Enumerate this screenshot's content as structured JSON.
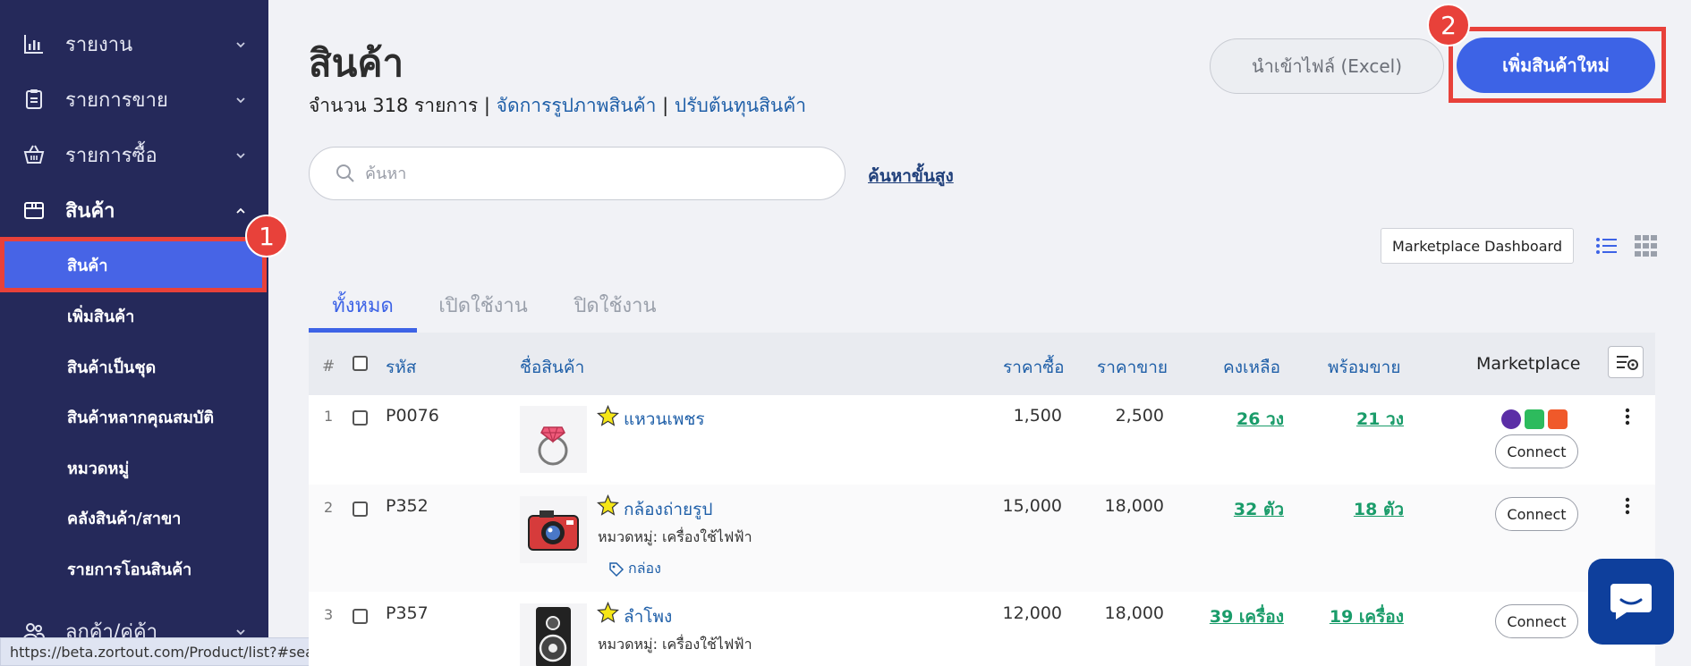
{
  "sidebar": {
    "items": [
      {
        "label": "รายงาน",
        "icon": "bar-chart-icon"
      },
      {
        "label": "รายการขาย",
        "icon": "clipboard-icon"
      },
      {
        "label": "รายการซื้อ",
        "icon": "basket-icon"
      },
      {
        "label": "สินค้า",
        "icon": "box-icon"
      },
      {
        "label": "ลูกค้า/คู่ค้า",
        "icon": "users-icon"
      }
    ],
    "subitems": [
      "สินค้า",
      "เพิ่มสินค้า",
      "สินค้าเป็นชุด",
      "สินค้าหลากคุณสมบัติ",
      "หมวดหมู่",
      "คลังสินค้า/สาขา",
      "รายการโอนสินค้า"
    ]
  },
  "badges": [
    "1",
    "2"
  ],
  "status_url": "https://beta.zortout.com/Product/list?#searchAdvance",
  "header": {
    "title": "สินค้า",
    "count_text": "จำนวน 318 รายการ |",
    "link_manage_images": "จัดการรูปภาพสินค้า",
    "separator": "|",
    "link_adjust_cost": "ปรับต้นทุนสินค้า",
    "import_button": "นำเข้าไฟล์ (Excel)",
    "add_button": "เพิ่มสินค้าใหม่"
  },
  "search": {
    "placeholder": "ค้นหา",
    "advanced_link": "ค้นหาขั้นสูง"
  },
  "marketplace_dashboard": "Marketplace Dashboard",
  "tabs": [
    "ทั้งหมด",
    "เปิดใช้งาน",
    "ปิดใช้งาน"
  ],
  "table": {
    "columns": {
      "hash": "#",
      "code": "รหัส",
      "name": "ชื่อสินค้า",
      "buy_price": "ราคาซื้อ",
      "sell_price": "ราคาขาย",
      "remaining": "คงเหลือ",
      "ready": "พร้อมขาย",
      "marketplace": "Marketplace"
    },
    "rows": [
      {
        "no": "1",
        "code": "P0076",
        "name": "แหวนเพชร",
        "category": "",
        "tag": "",
        "buy": "1,500",
        "sell": "2,500",
        "remaining": "26 วง",
        "ready": "21 วง",
        "connect": "Connect"
      },
      {
        "no": "2",
        "code": "P352",
        "name": "กล้องถ่ายรูป",
        "category": "หมวดหมู่: เครื่องใช้ไฟฟ้า",
        "tag": "กล่อง",
        "buy": "15,000",
        "sell": "18,000",
        "remaining": "32 ตัว",
        "ready": "18 ตัว",
        "connect": "Connect"
      },
      {
        "no": "3",
        "code": "P357",
        "name": "ลำโพง",
        "category": "หมวดหมู่: เครื่องใช้ไฟฟ้า",
        "tag": "",
        "buy": "12,000",
        "sell": "18,000",
        "remaining": "39 เครื่อง",
        "ready": "19 เครื่อง",
        "connect": "Connect"
      }
    ]
  },
  "colors": {
    "sidebar_bg": "#25295a",
    "accent_blue": "#3d63e6",
    "highlight_red": "#e8413a",
    "stock_green": "#1a9c6a",
    "link_blue": "#1f5fa8"
  }
}
